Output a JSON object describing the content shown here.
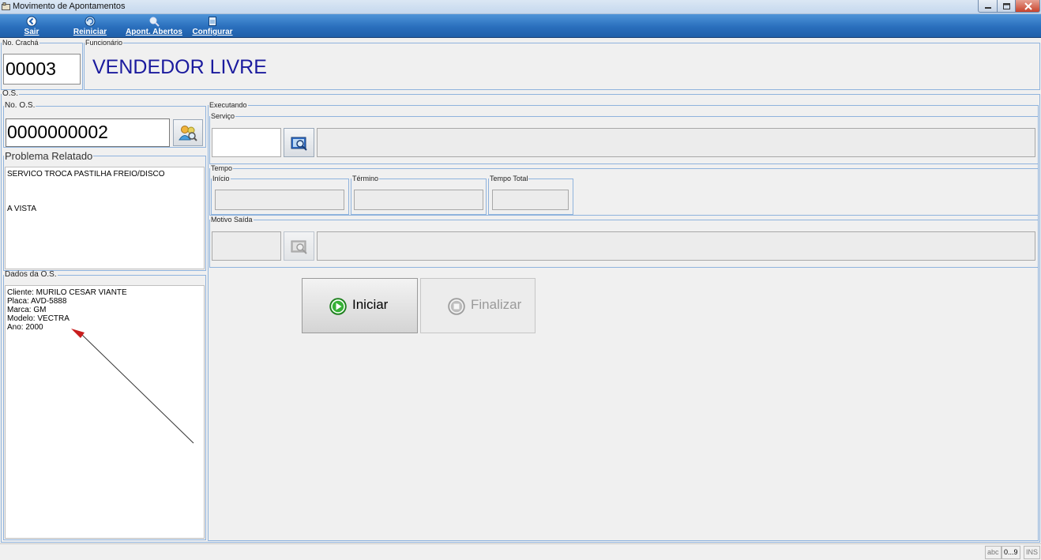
{
  "window": {
    "title": "Movimento de Apontamentos"
  },
  "toolbar": {
    "sair": "Sair",
    "reiniciar": "Reiniciar",
    "apont_abertos": "Apont. Abertos",
    "configurar": "Configurar"
  },
  "header": {
    "cracha_legend": "No. Crachá",
    "cracha_value": "00003",
    "funcionario_legend": "Funcionário",
    "funcionario_value": "VENDEDOR LIVRE"
  },
  "os": {
    "legend": "O.S.",
    "numero_legend": "No. O.S.",
    "numero_value": "0000000002",
    "problema_legend": "Problema Relatado",
    "problema_lines": [
      "SERVICO TROCA PASTILHA FREIO/DISCO",
      "",
      "",
      "",
      "A VISTA"
    ],
    "dados_legend": "Dados da O.S.",
    "dados_lines": [
      "Cliente: MURILO CESAR VIANTE",
      "Placa: AVD-5888",
      "Marca: GM",
      "Modelo: VECTRA",
      "Ano: 2000"
    ]
  },
  "executando": {
    "legend": "Executando",
    "servico_legend": "Serviço",
    "tempo_legend": "Tempo",
    "inicio_legend": "Início",
    "termino_legend": "Término",
    "tempo_total_legend": "Tempo Total",
    "motivo_legend": "Motivo Saída"
  },
  "actions": {
    "iniciar": "Iniciar",
    "finalizar": "Finalizar"
  },
  "statusbar": {
    "abc": "abc",
    "nums": "0...9",
    "ins": "INS"
  },
  "colors": {
    "toolbar": "#2a6fbd",
    "group_border": "#8fb3dd",
    "funcionario_text": "#1b1b9e",
    "iniciar_icon": "#2fa62f"
  }
}
